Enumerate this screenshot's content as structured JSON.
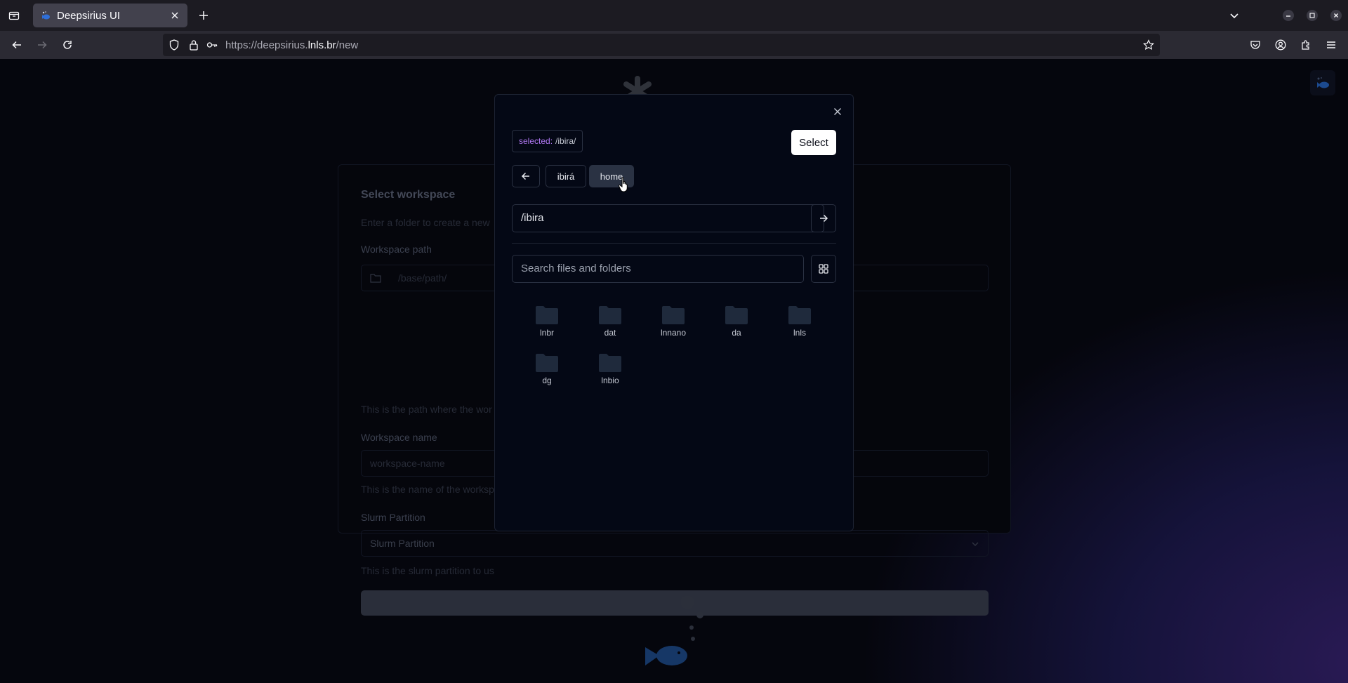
{
  "browser": {
    "tab_title": "Deepsirius UI",
    "url_prefix": "https://deepsirius.",
    "url_domain": "lnls.br",
    "url_path": "/new"
  },
  "background_form": {
    "title": "Select workspace",
    "subtitle": "Enter a folder to create a new",
    "path_label": "Workspace path",
    "path_placeholder": "/base/path/",
    "path_help": "This is the path where the wor",
    "name_label": "Workspace name",
    "name_placeholder": "workspace-name",
    "name_help": "This is the name of the worksp",
    "partition_label": "Slurm Partition",
    "partition_value": "Slurm Partition",
    "partition_help": "This is the slurm partition to us"
  },
  "modal": {
    "selected_key": "selected:",
    "selected_value": "/ibira/",
    "select_label": "Select",
    "breadcrumbs": [
      "ibirá",
      "home"
    ],
    "path_value": "/ibira",
    "search_placeholder": "Search files and folders",
    "folders": [
      "lnbr",
      "dat",
      "lnnano",
      "da",
      "lnls",
      "dg",
      "lnbio"
    ]
  },
  "colors": {
    "accent_purple": "#b078f2",
    "folder_fill": "#1f2a3c",
    "page_bg": "#05060d"
  }
}
